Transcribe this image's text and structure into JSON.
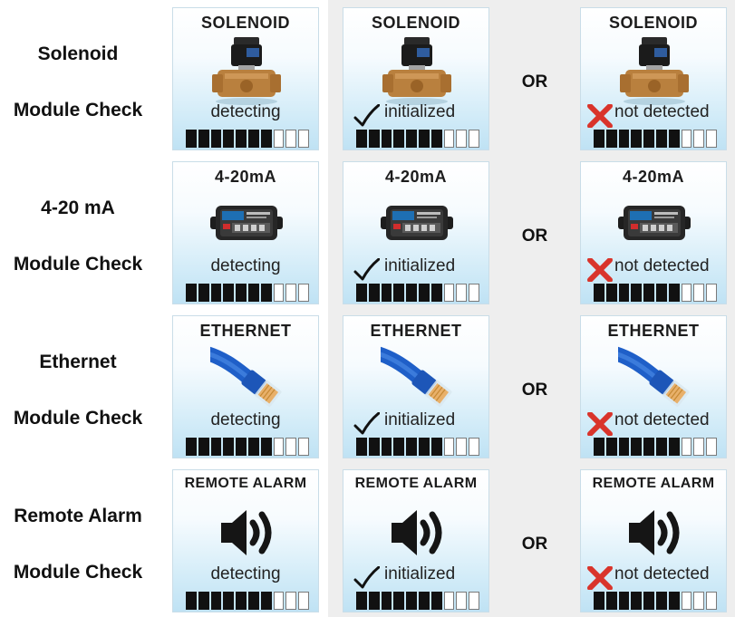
{
  "rows": [
    {
      "label_line1": "Solenoid",
      "label_line2": "Module Check",
      "title": "SOLENOID",
      "icon": "solenoid-valve-icon"
    },
    {
      "label_line1": "4-20 mA",
      "label_line2": "Module Check",
      "title": "4-20mA",
      "icon": "analog-module-icon"
    },
    {
      "label_line1": "Ethernet",
      "label_line2": "Module Check",
      "title": "ETHERNET",
      "icon": "ethernet-cable-icon"
    },
    {
      "label_line1": "Remote Alarm",
      "label_line2": "Module Check",
      "title": "REMOTE ALARM",
      "icon": "speaker-icon"
    }
  ],
  "or_label": "OR",
  "states": [
    {
      "text": "detecting",
      "mark": "none",
      "filled_segments": 7,
      "total_segments": 10
    },
    {
      "text": "initialized",
      "mark": "check-icon",
      "filled_segments": 7,
      "total_segments": 10
    },
    {
      "text": "not detected",
      "mark": "cross-icon",
      "filled_segments": 7,
      "total_segments": 10
    }
  ],
  "colors": {
    "panel_gradient_bottom": "#bfe2f4",
    "cross": "#d9342b",
    "check": "#111111",
    "bar_filled": "#111111"
  }
}
